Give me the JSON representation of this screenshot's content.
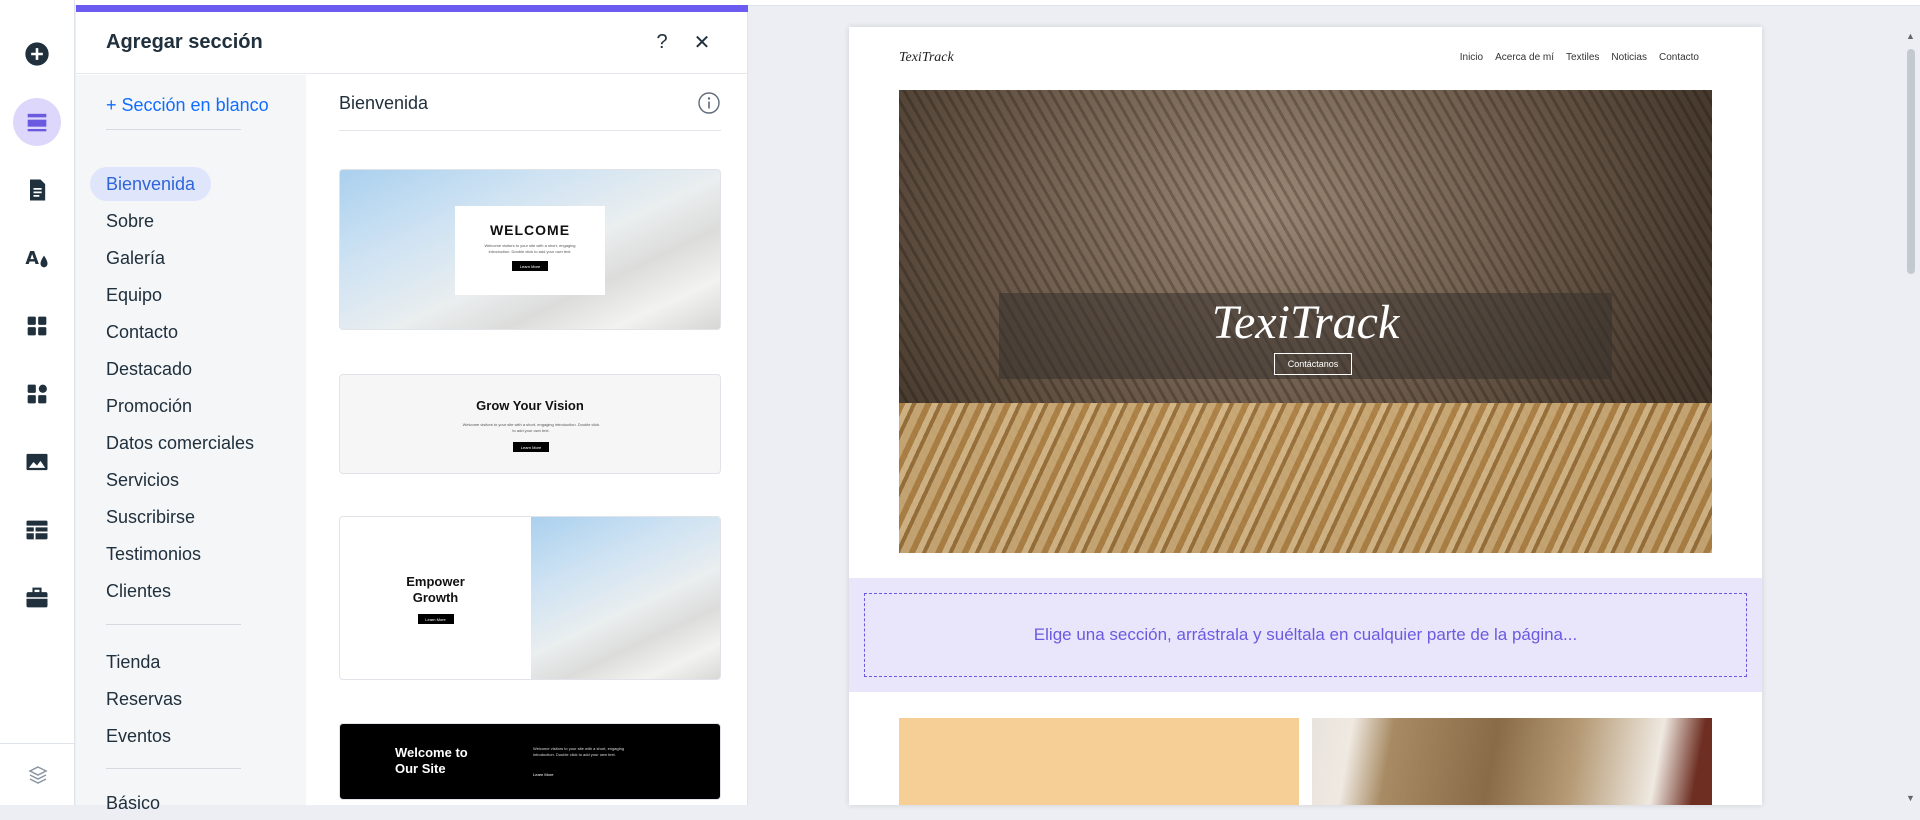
{
  "panel": {
    "title": "Agregar sección",
    "help_label": "?",
    "close_label": "✕",
    "blank_section": "+ Sección en blanco",
    "categories_group1": [
      "Bienvenida",
      "Sobre",
      "Galería",
      "Equipo",
      "Contacto",
      "Destacado",
      "Promoción",
      "Datos comerciales",
      "Servicios",
      "Suscribirse",
      "Testimonios",
      "Clientes"
    ],
    "categories_group2": [
      "Tienda",
      "Reservas",
      "Eventos"
    ],
    "categories_group3": [
      "Básico"
    ],
    "selected_category": "Bienvenida",
    "templates_header": "Bienvenida",
    "templates": [
      {
        "title": "WELCOME",
        "text": "Welcome visitors to your site with a short, engaging introduction. Double click to add your own text.",
        "button": "Learn More"
      },
      {
        "title": "Grow Your Vision",
        "text": "Welcome visitors to your site with a short, engaging introduction. Double click to add your own text.",
        "button": "Learn More"
      },
      {
        "title": "Empower Growth",
        "button": "Learn More"
      },
      {
        "title": "Welcome to Our Site",
        "text": "Welcome visitors to your site with a short, engaging introduction. Double click to add your own text.",
        "button": "Learn More"
      }
    ]
  },
  "site": {
    "logo": "TexiTrack",
    "nav": [
      "Inicio",
      "Acerca de mí",
      "Textiles",
      "Noticias",
      "Contacto"
    ],
    "hero_title": "TexiTrack",
    "hero_button": "Contáctanos",
    "drop_hint": "Elige una sección, arrástrala y suéltala en cualquier parte de la página..."
  },
  "colors": {
    "accent": "#6b5bf0",
    "selected_bg": "#dfe6fb",
    "blank_link": "#116dff",
    "peach_block": "#f5cf96"
  },
  "rail_icons": [
    "add-icon",
    "sections-icon",
    "pages-icon",
    "design-icon",
    "apps-icon",
    "add-apps-icon",
    "media-icon",
    "cms-icon",
    "business-icon",
    "layers-icon"
  ]
}
